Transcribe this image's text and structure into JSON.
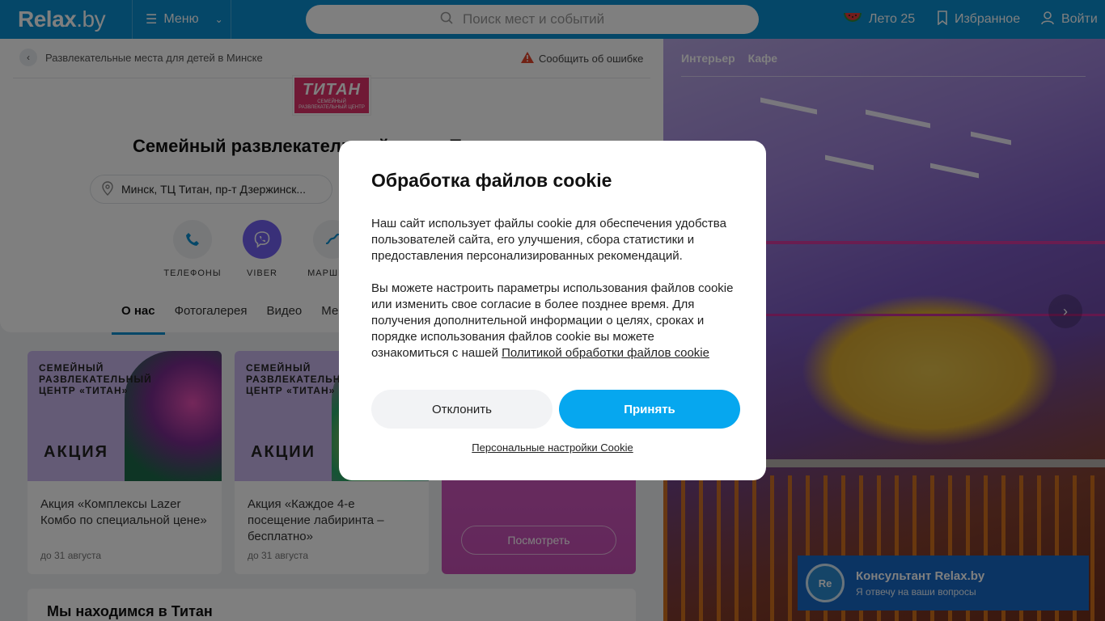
{
  "header": {
    "logo": "Relax",
    "logo_suffix": ".by",
    "menu_label": "Меню",
    "search_placeholder": "Поиск мест и событий",
    "leto": "Лето 25",
    "favorites": "Избранное",
    "login": "Войти"
  },
  "breadcrumb": "Развлекательные места для детей в Минске",
  "report_error": "Сообщить об ошибке",
  "place": {
    "logo_text": "ТИТАН",
    "logo_sub": "СЕМЕЙНЫЙ РАЗВЛЕКАТЕЛЬНЫЙ ЦЕНТР",
    "title": "Семейный развлекательный центр Титан",
    "address": "Минск, ТЦ Титан, пр-т Дзержинск..."
  },
  "actions": [
    {
      "label": "ТЕЛЕФОНЫ",
      "icon": "phone-icon"
    },
    {
      "label": "VIBER",
      "icon": "viber-icon"
    },
    {
      "label": "МАРШРУТ",
      "icon": "route-icon"
    }
  ],
  "tabs": [
    "О нас",
    "Фотогалерея",
    "Видео",
    "Меню"
  ],
  "promos": [
    {
      "header": "СЕМЕЙНЫЙ РАЗВЛЕКАТЕЛЬНЫЙ ЦЕНТР «ТИТАН»",
      "badge": "АКЦИЯ",
      "title": "Акция «Комплексы Lazer Комбо по специальной цене»",
      "date": "до 31 августа"
    },
    {
      "header": "СЕМЕЙНЫЙ РАЗВЛЕКАТЕЛЬНЫЙ ЦЕНТР «ТИТАН»",
      "badge": "АКЦИИ",
      "title": "Акция «Каждое 4-е посещение лабиринта – бесплатно»",
      "date": "до 31 августа"
    }
  ],
  "promo3_button": "Посмотреть",
  "location_title": "Мы находимся в Титан",
  "photo_tabs": [
    "Интерьер",
    "Кафе"
  ],
  "consultant": {
    "avatar": "Re",
    "name": "Консультант Relax.by",
    "subtitle": "Я отвечу на ваши вопросы"
  },
  "cookie": {
    "title": "Обработка файлов cookie",
    "p1": "Наш сайт использует файлы cookie для обеспечения удобства пользователей сайта, его улучшения, сбора статистики и предоставления персонализированных рекомендаций.",
    "p2": "Вы можете настроить параметры использования файлов cookie или изменить свое согласие в более позднее время. Для получения дополнительной информации о целях, сроках и порядке использования файлов cookie вы можете ознакомиться с нашей",
    "policy_link": "Политикой обработки файлов cookie",
    "decline": "Отклонить",
    "accept": "Принять",
    "settings": "Персональные настройки Cookie"
  },
  "colors": {
    "brand_blue": "#0a8fd0",
    "accept_blue": "#06a7ef",
    "titan_pink": "#e0336a"
  }
}
